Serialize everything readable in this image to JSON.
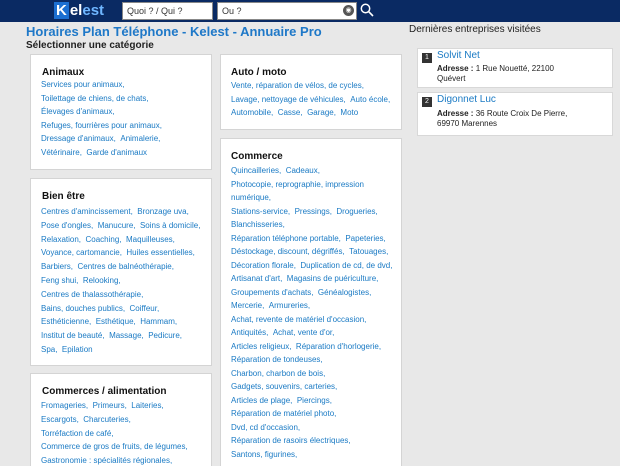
{
  "header": {
    "logo": {
      "k": "K",
      "el": "el",
      "est": "est"
    },
    "search_what_placeholder": "Quoi ? / Qui ?",
    "search_where_placeholder": "Ou ?"
  },
  "page": {
    "title": "Horaires Plan Téléphone - Kelest - Annuaire Pro",
    "subtitle": "Sélectionner une catégorie"
  },
  "categories": {
    "animaux": {
      "title": "Animaux",
      "rows": [
        [
          "Services pour animaux,"
        ],
        [
          "Toilettage de chiens, de chats,"
        ],
        [
          "Élevages d'animaux,"
        ],
        [
          "Refuges, fourrières pour animaux,"
        ],
        [
          "Dressage d'animaux,",
          "Animalerie,"
        ],
        [
          "Vétérinaire,",
          "Garde d'animaux"
        ]
      ]
    },
    "auto": {
      "title": "Auto / moto",
      "rows": [
        [
          "Vente, réparation de vélos, de cycles,"
        ],
        [
          "Lavage, nettoyage de véhicules,",
          "Auto école,"
        ],
        [
          "Automobile,",
          "Casse,",
          "Garage,",
          "Moto"
        ]
      ]
    },
    "bienetre": {
      "title": "Bien être",
      "rows": [
        [
          "Centres d'amincissement,",
          "Bronzage uva,"
        ],
        [
          "Pose d'ongles,",
          "Manucure,",
          "Soins à domicile,"
        ],
        [
          "Relaxation,",
          "Coaching,",
          "Maquilleuses,"
        ],
        [
          "Voyance, cartomancie,",
          "Huiles essentielles,"
        ],
        [
          "Barbiers,",
          "Centres de balnéothérapie,"
        ],
        [
          "Feng shui,",
          "Relooking,"
        ],
        [
          "Centres de thalassothérapie,"
        ],
        [
          "Bains, douches publics,",
          "Coiffeur,"
        ],
        [
          "Esthéticienne,",
          "Esthétique,",
          "Hammam,"
        ],
        [
          "Institut de beauté,",
          "Massage,",
          "Pedicure,"
        ],
        [
          "Spa,",
          "Epilation"
        ]
      ]
    },
    "commerces_alim": {
      "title": "Commerces / alimentation",
      "rows": [
        [
          "Fromageries,",
          "Primeurs,",
          "Laiteries,"
        ],
        [
          "Escargots,",
          "Charcuteries,"
        ],
        [
          "Torréfaction de café,"
        ],
        [
          "Commerce de gros de fruits, de légumes,"
        ],
        [
          "Gastronomie : spécialités régionales,"
        ]
      ]
    },
    "commerce": {
      "title": "Commerce",
      "rows": [
        [
          "Quincailleries,",
          "Cadeaux,"
        ],
        [
          "Photocopie, reprographie, impression"
        ],
        [
          "numérique,"
        ],
        [
          "Stations-service,",
          "Pressings,",
          "Drogueries,"
        ],
        [
          "Blanchisseries,"
        ],
        [
          "Réparation téléphone portable,",
          "Papeteries,"
        ],
        [
          "Déstockage, discount, dégriffés,",
          "Tatouages,"
        ],
        [
          "Décoration florale,",
          "Duplication de cd, de dvd,"
        ],
        [
          "Artisanat d'art,",
          "Magasins de puériculture,"
        ],
        [
          "Groupements d'achats,",
          "Généalogistes,"
        ],
        [
          "Mercerie,",
          "Armureries,"
        ],
        [
          "Achat, revente de matériel d'occasion,"
        ],
        [
          "Antiquités,",
          "Achat, vente d'or,"
        ],
        [
          "Articles religieux,",
          "Réparation d'horlogerie,"
        ],
        [
          "Réparation de tondeuses,"
        ],
        [
          "Charbon, charbon de bois,"
        ],
        [
          "Gadgets, souvenirs, carteries,"
        ],
        [
          "Articles de plage,",
          "Piercings,"
        ],
        [
          "Réparation de matériel photo,"
        ],
        [
          "Dvd, cd d'occasion,"
        ],
        [
          "Réparation de rasoirs électriques,"
        ],
        [
          "Santons, figurines,"
        ]
      ]
    }
  },
  "sidebar": {
    "title": "Dernières entreprises visitées",
    "address_label": "Adresse :",
    "items": [
      {
        "num": "1",
        "name": "Solvit Net",
        "address_line1": "1 Rue Nouetté, 22100",
        "address_line2": "Quévert"
      },
      {
        "num": "2",
        "name": "Digonnet Luc",
        "address_line1": "36 Route Croix De Pierre,",
        "address_line2": "69970 Marennes"
      }
    ]
  },
  "colors": {
    "header_bg": "#0a2a63",
    "link": "#1a7ac4",
    "title": "#1e78c8"
  }
}
